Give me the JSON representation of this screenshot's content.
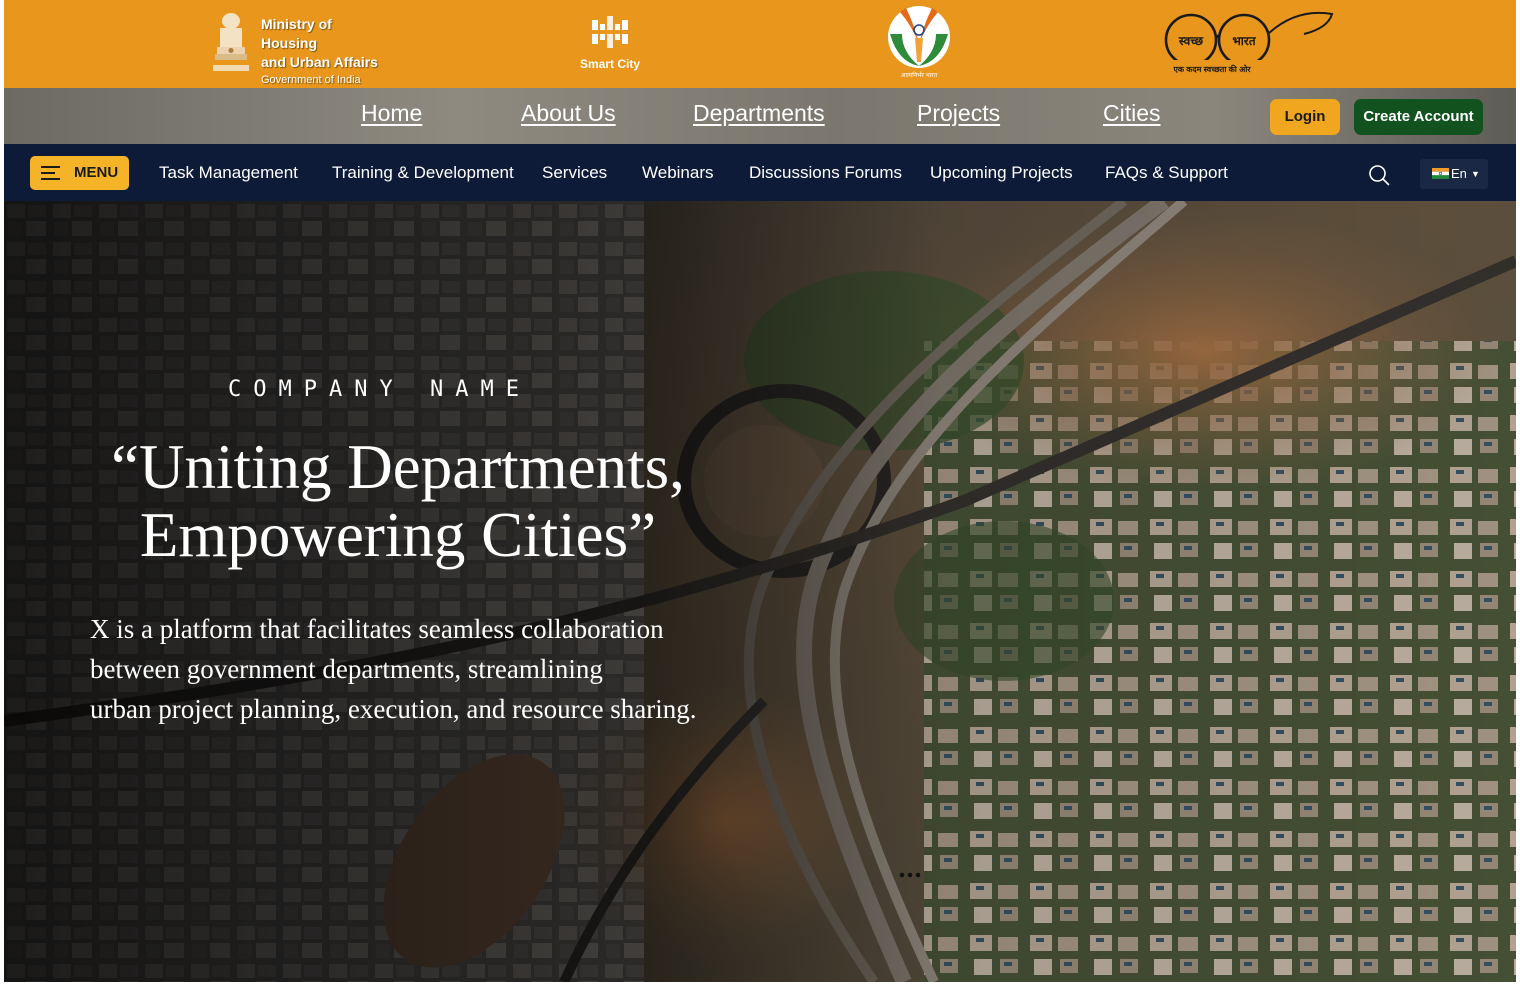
{
  "header": {
    "ministry_line1": "Ministry of Housing",
    "ministry_line2": "and Urban Affairs",
    "ministry_line3": "Government of India",
    "emblem_caption": "सत्यमेव जयते",
    "smart_city_label": "Smart City",
    "nirbhar_caption": "आत्मनिर्भर भारत",
    "swachh_word1": "स्वच्छ",
    "swachh_word2": "भारत",
    "swachh_caption": "एक कदम स्वच्छता की ओर",
    "band_color": "#e8961c"
  },
  "main_nav": {
    "links": [
      "Home",
      "About Us",
      "Departments",
      "Projects",
      "Cities"
    ],
    "login_label": "Login",
    "create_account_label": "Create Account",
    "login_color": "#f0a71f",
    "create_color": "#11521e"
  },
  "sub_nav": {
    "menu_label": "MENU",
    "links": [
      "Task Management",
      "Training & Development",
      "Services",
      "Webinars",
      "Discussions Forums",
      "Upcoming Projects",
      "FAQs & Support"
    ],
    "language": "En",
    "search_icon": "search-icon",
    "background": "#0d1b38"
  },
  "hero": {
    "company_name": "COMPANY NAME",
    "headline_line1": "“Uniting Departments,",
    "headline_line2": "Empowering Cities”",
    "description_line1": "X is a platform that facilitates seamless collaboration",
    "description_line2": "between government departments, streamlining",
    "description_line3": "urban project planning, execution, and resource sharing.",
    "carousel_indicator": "more-dots-icon"
  }
}
